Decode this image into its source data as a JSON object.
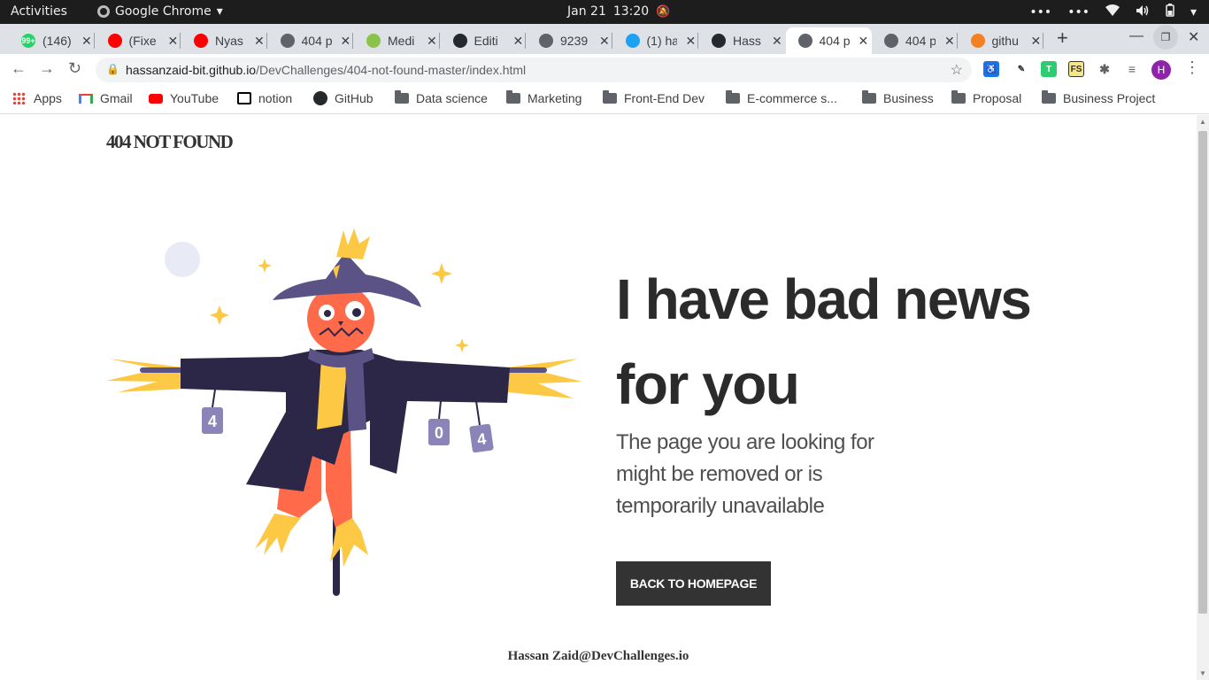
{
  "os_bar": {
    "activities": "Activities",
    "app_name": "Google Chrome",
    "date": "Jan 21",
    "time": "13:20"
  },
  "tabs": [
    {
      "title": "(146)",
      "favicon": "whatsapp-icon",
      "color": "#25d366",
      "badge": "99+"
    },
    {
      "title": "(Fixe",
      "favicon": "youtube-icon",
      "color": "#ff0000"
    },
    {
      "title": "Nyas",
      "favicon": "youtube-icon",
      "color": "#ff0000"
    },
    {
      "title": "404 p",
      "favicon": "globe-icon",
      "color": "#5f6368"
    },
    {
      "title": "Medi",
      "favicon": "medium-spark-icon",
      "color": "#8bc34a"
    },
    {
      "title": "Editi",
      "favicon": "github-icon",
      "color": "#24292e"
    },
    {
      "title": "9239",
      "favicon": "globe-icon",
      "color": "#5f6368"
    },
    {
      "title": "(1) ha",
      "favicon": "twitter-icon",
      "color": "#1da1f2"
    },
    {
      "title": "Hass",
      "favicon": "github-icon",
      "color": "#24292e"
    },
    {
      "title": "404 p",
      "favicon": "globe-icon",
      "color": "#5f6368",
      "active": true
    },
    {
      "title": "404 p",
      "favicon": "globe-icon",
      "color": "#5f6368"
    },
    {
      "title": "githu",
      "favicon": "stackoverflow-icon",
      "color": "#f48024"
    }
  ],
  "address_bar": {
    "host": "hassanzaid-bit.github.io",
    "path": "/DevChallenges/404-not-found-master/index.html"
  },
  "profile_initial": "H",
  "bookmarks": [
    {
      "label": "Apps",
      "icon": "apps-grid-icon"
    },
    {
      "label": "Gmail",
      "icon": "gmail-icon"
    },
    {
      "label": "YouTube",
      "icon": "youtube-icon"
    },
    {
      "label": "notion",
      "icon": "notion-icon"
    },
    {
      "label": "GitHub",
      "icon": "github-icon"
    },
    {
      "label": "Data science",
      "icon": "folder-icon"
    },
    {
      "label": "Marketing",
      "icon": "folder-icon"
    },
    {
      "label": "Front-End Dev",
      "icon": "folder-icon"
    },
    {
      "label": "E-commerce s...",
      "icon": "folder-icon"
    },
    {
      "label": "Business",
      "icon": "folder-icon"
    },
    {
      "label": "Proposal",
      "icon": "folder-icon"
    },
    {
      "label": "Business Project",
      "icon": "folder-icon"
    }
  ],
  "page": {
    "logo": "404 NOT FOUND",
    "headline_line1": "I have bad news",
    "headline_line2": "for you",
    "subtext_line1": "The page you are looking for",
    "subtext_line2": "might be removed or is",
    "subtext_line3": "temporarily unavailable",
    "button_label": "BACK TO HOMEPAGE",
    "footer": "Hassan Zaid@DevChallenges.io",
    "sign_digits": [
      "4",
      "0",
      "4"
    ]
  },
  "colors": {
    "accent_dark": "#333333",
    "scarecrow_coat": "#2c2747",
    "scarecrow_hat": "#5b5385",
    "scarecrow_face": "#ff6b4a",
    "straw": "#fdc844"
  }
}
